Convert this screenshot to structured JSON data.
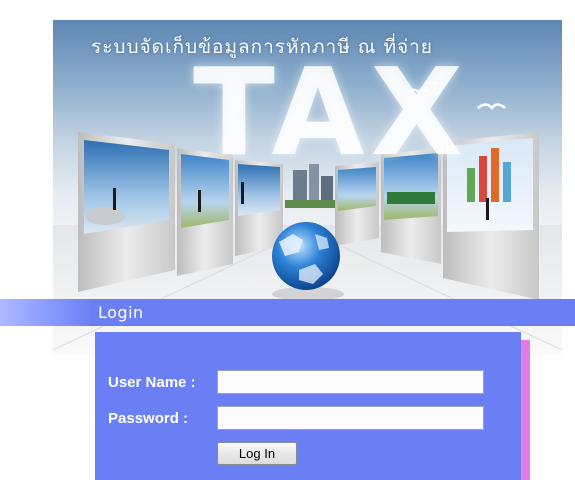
{
  "banner": {
    "title": "ระบบจัดเก็บข้อมูลการหักภาษี ณ ที่จ่าย",
    "big_word": "TAX"
  },
  "login_section": {
    "heading": "Login"
  },
  "form": {
    "username_label": "User Name :",
    "username_value": "",
    "password_label": "Password :",
    "password_value": "",
    "submit_label": "Log In"
  },
  "colors": {
    "login_bar": "#6b7ff4",
    "form_panel": "#6b7ff4",
    "panel_accent": "#e57ae6"
  }
}
